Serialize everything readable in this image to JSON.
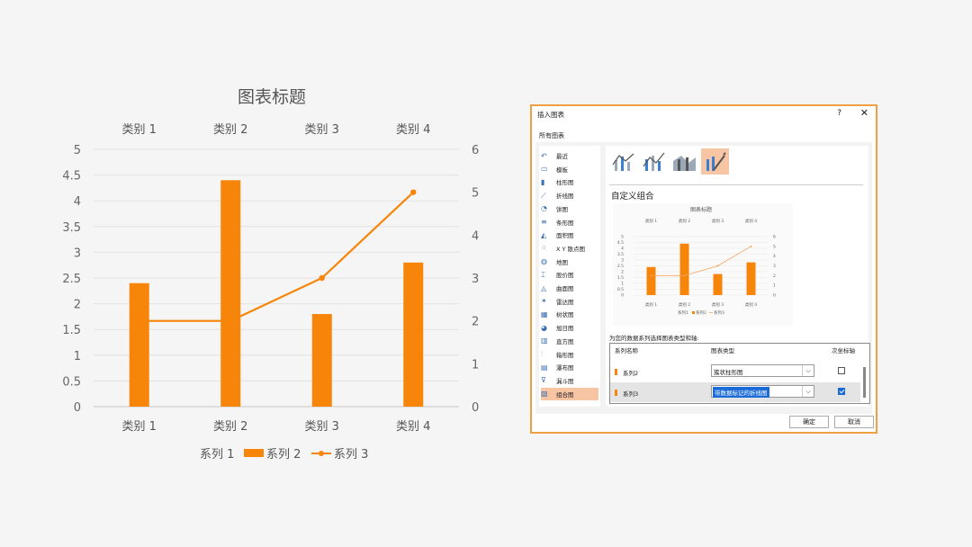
{
  "chart_data": {
    "type": "bar",
    "title": "图表标题",
    "categories": [
      "类别 1",
      "类别 2",
      "类别 3",
      "类别 4"
    ],
    "series": [
      {
        "name": "系列 1",
        "values": [
          0,
          0,
          0,
          0
        ]
      },
      {
        "name": "系列 2",
        "values": [
          2.4,
          4.4,
          1.8,
          2.8
        ],
        "kind": "bar",
        "color": "#f7850a"
      },
      {
        "name": "系列 3",
        "values": [
          2,
          2,
          3,
          5
        ],
        "kind": "line",
        "axis": "secondary",
        "color": "#f7850a"
      }
    ],
    "ylim": [
      0,
      5
    ],
    "y2lim": [
      0,
      6
    ],
    "yticks": [
      "0",
      "0.5",
      "1",
      "1.5",
      "2",
      "2.5",
      "3",
      "3.5",
      "4",
      "4.5",
      "5"
    ],
    "y2ticks": [
      "0",
      "1",
      "2",
      "3",
      "4",
      "5",
      "6"
    ],
    "grid": true,
    "legend": "bottom"
  },
  "dialog": {
    "title": "插入图表",
    "help": "?",
    "close": "✕",
    "tab": "所有图表",
    "types": [
      "最近",
      "模板",
      "柱形图",
      "折线图",
      "饼图",
      "条形图",
      "面积图",
      "X Y 散点图",
      "地图",
      "股价图",
      "曲面图",
      "雷达图",
      "树状图",
      "旭日图",
      "直方图",
      "箱形图",
      "瀑布图",
      "漏斗图",
      "组合图"
    ],
    "section_title": "自定义组合",
    "preview": {
      "title": "图表标题",
      "categories": [
        "类别 1",
        "类别 2",
        "类别 3",
        "类别 4"
      ],
      "yticks": [
        "0",
        "0.5",
        "1",
        "1.5",
        "2",
        "2.5",
        "3",
        "3.5",
        "4",
        "4.5",
        "5"
      ],
      "y2ticks": [
        "0",
        "1",
        "2",
        "3",
        "4",
        "5",
        "6"
      ],
      "legend": [
        "系列1",
        "系列2",
        "系列3"
      ]
    },
    "prompt": "为您的数据系列选择图表类型和轴:",
    "headers": {
      "name": "系列名称",
      "type": "图表类型",
      "axis": "次坐标轴"
    },
    "rows": [
      {
        "name": "系列2",
        "type": "簇状柱形图",
        "secondary": false
      },
      {
        "name": "系列3",
        "type": "带数据标记的折线图",
        "secondary": true
      }
    ],
    "ok": "确定",
    "cancel": "取消"
  },
  "colors": {
    "accent": "#f7850a",
    "selection": "#f7c4a4",
    "highlight": "#1a6bd8"
  }
}
